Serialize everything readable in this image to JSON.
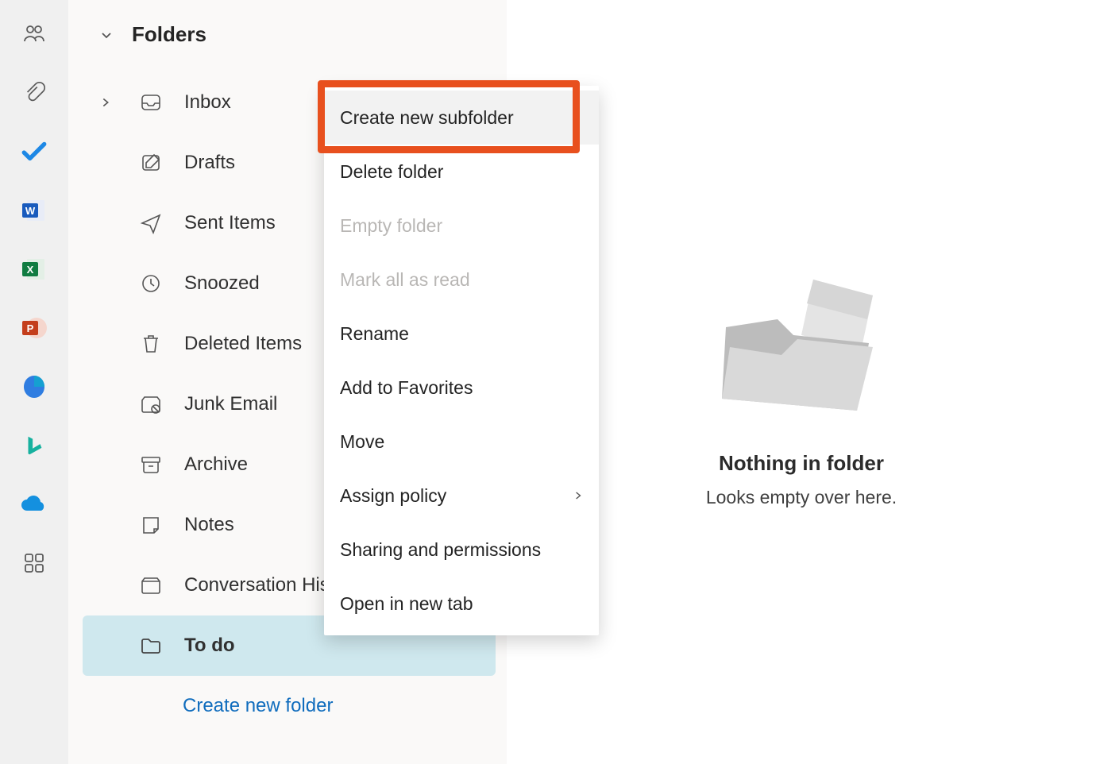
{
  "rail": {
    "icons": [
      {
        "name": "people-icon"
      },
      {
        "name": "attachment-icon"
      },
      {
        "name": "todo-icon"
      },
      {
        "name": "word-icon"
      },
      {
        "name": "excel-icon"
      },
      {
        "name": "powerpoint-icon"
      },
      {
        "name": "viva-icon"
      },
      {
        "name": "bing-icon"
      },
      {
        "name": "onedrive-icon"
      },
      {
        "name": "more-apps-icon"
      }
    ]
  },
  "folders": {
    "header": "Folders",
    "items": [
      {
        "label": "Inbox",
        "icon": "inbox-icon",
        "expandable": true
      },
      {
        "label": "Drafts",
        "icon": "drafts-icon"
      },
      {
        "label": "Sent Items",
        "icon": "sent-icon"
      },
      {
        "label": "Snoozed",
        "icon": "snoozed-icon"
      },
      {
        "label": "Deleted Items",
        "icon": "deleted-icon"
      },
      {
        "label": "Junk Email",
        "icon": "junk-icon"
      },
      {
        "label": "Archive",
        "icon": "archive-icon"
      },
      {
        "label": "Notes",
        "icon": "notes-icon"
      },
      {
        "label": "Conversation History",
        "icon": "conversation-icon"
      },
      {
        "label": "To do",
        "icon": "folder-icon",
        "selected": true
      }
    ],
    "create_label": "Create new folder"
  },
  "context_menu": {
    "items": [
      {
        "label": "Create new subfolder",
        "hovered": true
      },
      {
        "label": "Delete folder"
      },
      {
        "label": "Empty folder",
        "disabled": true
      },
      {
        "label": "Mark all as read",
        "disabled": true
      },
      {
        "label": "Rename"
      },
      {
        "label": "Add to Favorites"
      },
      {
        "label": "Move"
      },
      {
        "label": "Assign policy",
        "submenu": true
      },
      {
        "label": "Sharing and permissions"
      },
      {
        "label": "Open in new tab"
      }
    ]
  },
  "empty_state": {
    "title": "Nothing in folder",
    "subtitle": "Looks empty over here."
  },
  "colors": {
    "highlight": "#e8501e",
    "link": "#0f6cbd",
    "selected_bg": "#cfe8ee"
  }
}
